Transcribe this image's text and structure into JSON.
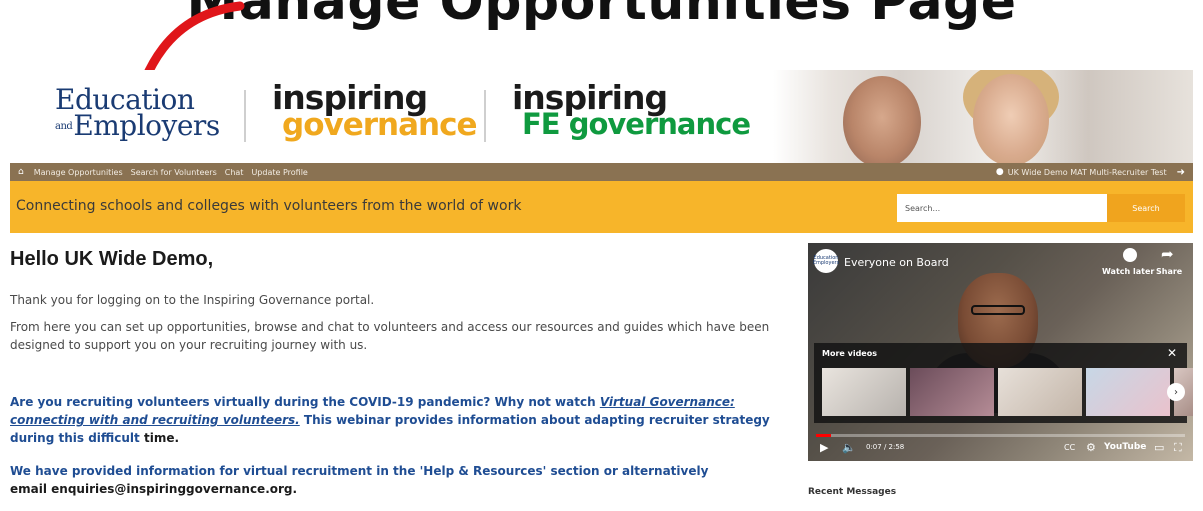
{
  "caption": {
    "text": "Manage Opportunities Page"
  },
  "logos": {
    "ee_line1": "Education",
    "ee_small": "and",
    "ee_line2": "Employers",
    "ig_top": "inspiring",
    "ig_bottom": "governance",
    "fe_top": "inspiring",
    "fe_bottom": "FE governance"
  },
  "nav": {
    "items": [
      "Manage Opportunities",
      "Search for Volunteers",
      "Chat",
      "Update Profile"
    ],
    "user": "UK Wide Demo MAT Multi-Recruiter Test"
  },
  "banner": {
    "tagline": "Connecting schools and colleges with volunteers from the world of work",
    "search_placeholder": "Search...",
    "search_button": "Search"
  },
  "main": {
    "greeting": "Hello UK Wide Demo,",
    "p1": "Thank you for logging on to the Inspiring Governance portal.",
    "p2": "From here you can set up opportunities, browse and chat to volunteers and access our resources and guides which have been designed to support you on your recruiting journey with us.",
    "covid_lead": "Are you recruiting volunteers virtually during the COVID-19 pandemic? Why not watch ",
    "covid_link": "Virtual Governance: connecting with and recruiting volunteers.",
    "covid_tail": " This webinar provides information about adapting recruiter strategy during this difficult ",
    "covid_end": "time.",
    "virtual_lead": "We have provided information for virtual recruitment in the 'Help & Resources' section or alternatively",
    "virtual_email": "email enquiries@inspiringgovernance.org."
  },
  "video": {
    "channel": "Education Employers",
    "title": "Everyone on Board",
    "watch_later": "Watch later",
    "share": "Share",
    "more_videos": "More videos",
    "time": "0:07 / 2:58",
    "progress": 0.04,
    "youtube": "YouTube"
  },
  "recent_messages": "Recent Messages"
}
